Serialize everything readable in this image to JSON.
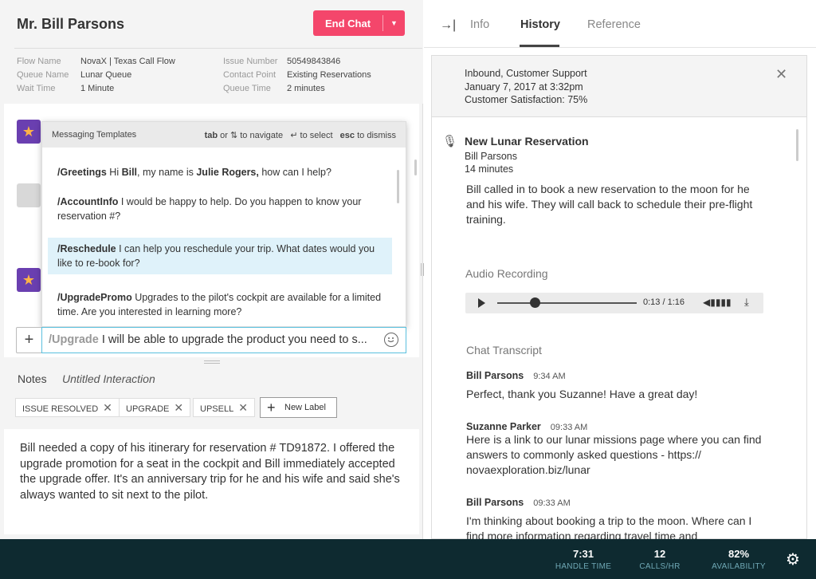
{
  "header": {
    "customer_name": "Mr. Bill Parsons",
    "end_chat_label": "End Chat",
    "meta_left": [
      {
        "key": "Flow Name",
        "value": "NovaX | Texas Call Flow"
      },
      {
        "key": "Queue Name",
        "value": "Lunar Queue"
      },
      {
        "key": "Wait Time",
        "value": "1 Minute"
      }
    ],
    "meta_right": [
      {
        "key": "Issue Number",
        "value": "50549843846"
      },
      {
        "key": "Contact Point",
        "value": "Existing Reservations"
      },
      {
        "key": "Queue Time",
        "value": "2 minutes"
      }
    ]
  },
  "templates": {
    "title": "Messaging Templates",
    "hint_tab": "tab",
    "hint_or": "or",
    "hint_navigate": "to navigate",
    "hint_select": "to select",
    "hint_esc": "esc",
    "hint_dismiss": "to dismiss",
    "items": [
      {
        "cmd": "/Greetings",
        "pre": " Hi ",
        "bold_name": "Bill",
        "mid": ", my name is ",
        "bold_agent": "Julie Rogers,",
        "post": "  how can I help?"
      },
      {
        "cmd": "/AccountInfo",
        "text": " I would be happy to help.  Do you happen to know your reservation #?"
      },
      {
        "cmd": "/Reschedule",
        "text": " I can help you reschedule your trip.  What dates would you like to re-book for?"
      },
      {
        "cmd": "/UpgradePromo",
        "text": " Upgrades to the pilot's cockpit are available for a limited time.  Are you interested in learning more?"
      }
    ]
  },
  "composer": {
    "cmd": "/Upgrade",
    "text": " I will be able to upgrade the product you need to s..."
  },
  "notes": {
    "tab_label": "Notes",
    "title": "Untitled Interaction",
    "labels": [
      "ISSUE RESOLVED",
      "UPGRADE",
      "UPSELL"
    ],
    "new_label": "New Label",
    "body": "Bill needed a copy of his itinerary for reservation # TD91872.  I offered the upgrade promotion for a seat in the cockpit and Bill immediately accepted the upgrade offer.  It's an anniversary trip for he and his wife and said she's always wanted to sit next to the pilot."
  },
  "right_tabs": [
    "Info",
    "History",
    "Reference"
  ],
  "history": {
    "head_lines": [
      "Inbound, Customer Support",
      "January 7, 2017 at 3:32pm",
      "Customer Satisfaction: 75%"
    ],
    "title": "New Lunar Reservation",
    "customer": "Bill Parsons",
    "duration": "14 minutes",
    "summary": "Bill called in to book a new reservation to the moon for he and his wife.  They will call back to schedule their pre-flight training.",
    "audio_label": "Audio Recording",
    "audio_progress": 0.27,
    "audio_time": "0:13 / 1:16",
    "transcript_label": "Chat Transcript",
    "messages": [
      {
        "author": "Bill Parsons",
        "time": "9:34 AM",
        "text": "Perfect, thank you Suzanne!  Have a great day!"
      },
      {
        "author": "Suzanne Parker",
        "time": "09:33 AM",
        "text": "Here is a link to our lunar missions page where you can find answers to commonly asked questions - https:// novaexploration.biz/lunar"
      },
      {
        "author": "Bill Parsons",
        "time": "09:33 AM",
        "text": "I'm thinking about booking a trip to the moon.  Where can I find more information regarding travel time and"
      }
    ]
  },
  "footer": {
    "stats": [
      {
        "value": "7:31",
        "label": "HANDLE TIME"
      },
      {
        "value": "12",
        "label": "CALLS/HR"
      },
      {
        "value": "82%",
        "label": "AVAILABILITY"
      }
    ]
  },
  "colors": {
    "accent": "#f4466b",
    "footer": "#0e2a30",
    "selected": "#dff2fa"
  }
}
